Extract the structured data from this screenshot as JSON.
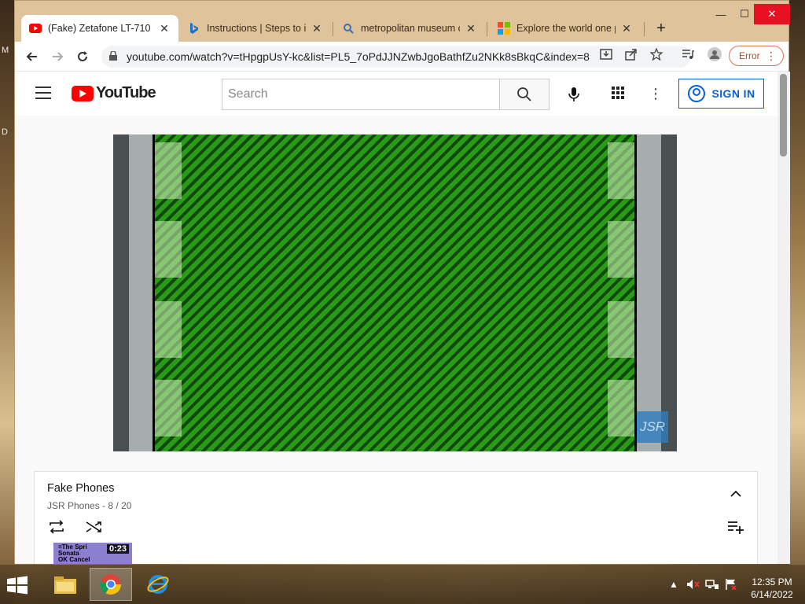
{
  "desktop": {
    "left_letters": [
      "M",
      "D"
    ]
  },
  "browser": {
    "tabs": [
      {
        "title": "(Fake) Zetafone LT-710 -",
        "icon": "youtube-favicon",
        "active": true
      },
      {
        "title": "Instructions | Steps to ins",
        "icon": "bing-favicon",
        "active": false
      },
      {
        "title": "metropolitan museum of",
        "icon": "search-favicon",
        "active": false
      },
      {
        "title": "Explore the world one pl",
        "icon": "microsoft-favicon",
        "active": false
      }
    ],
    "new_tab_label": "+",
    "window_controls": {
      "minimize": "—",
      "maximize": "☐",
      "close": "✕"
    },
    "url": "youtube.com/watch?v=tHpgpUsY-kc&list=PL5_7oPdJJNZwbJgoBathfZu2NKk8sBkqC&index=8",
    "error_label": "Error"
  },
  "youtube": {
    "logo_text": "YouTube",
    "search_placeholder": "Search",
    "sign_in_label": "SIGN IN",
    "watermark_text": "JSR",
    "playlist": {
      "title": "Fake Phones",
      "channel": "JSR Phones",
      "position": "8 / 20",
      "thumb_lines": [
        "=The Spri",
        "Sonata",
        "OK      Cancel"
      ],
      "thumb_duration": "0:23"
    }
  },
  "taskbar": {
    "apps": [
      "file-explorer",
      "chrome",
      "internet-explorer"
    ],
    "time": "12:35 PM",
    "date": "6/14/2022"
  }
}
